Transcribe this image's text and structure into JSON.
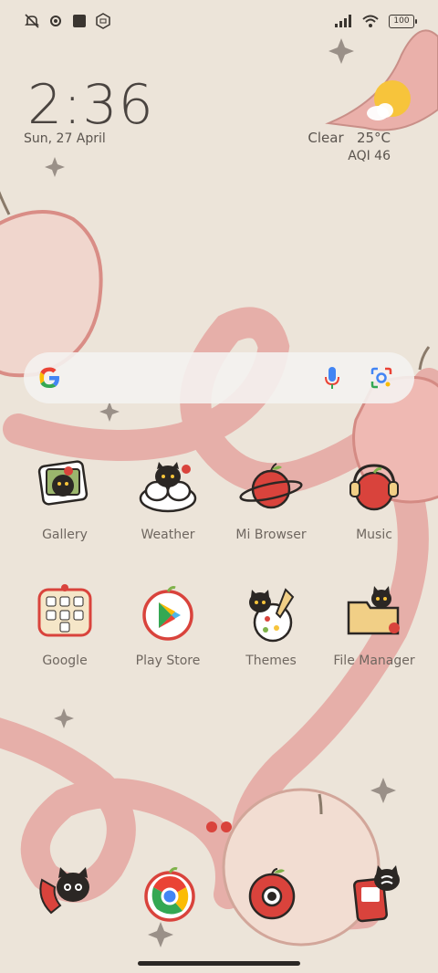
{
  "status_bar": {
    "left_icons": [
      "silent-icon",
      "settings-gear-icon",
      "square-notification-icon",
      "mi-shield-icon"
    ],
    "right_icons": [
      "signal-icon",
      "wifi-icon"
    ],
    "battery": "100"
  },
  "clock": {
    "time": "2:36",
    "date": "Sun, 27 April"
  },
  "weather": {
    "condition": "Clear",
    "temperature": "25°C",
    "aqi": "AQI 46"
  },
  "search": {
    "icons": [
      "google-g-icon",
      "microphone-icon",
      "google-lens-icon"
    ]
  },
  "apps_row1": [
    {
      "label": "Gallery",
      "icon": "gallery-icon"
    },
    {
      "label": "Weather",
      "icon": "weather-app-icon"
    },
    {
      "label": "Mi Browser",
      "icon": "mi-browser-icon"
    },
    {
      "label": "Music",
      "icon": "music-icon"
    }
  ],
  "apps_row2": [
    {
      "label": "Google",
      "icon": "google-folder-icon"
    },
    {
      "label": "Play Store",
      "icon": "play-store-icon"
    },
    {
      "label": "Themes",
      "icon": "themes-icon"
    },
    {
      "label": "File Manager",
      "icon": "file-manager-icon"
    }
  ],
  "dock": [
    "phone-cat-icon",
    "chrome-icon",
    "camera-icon",
    "messages-icon"
  ],
  "colors": {
    "accent_red": "#d9433c",
    "peel_pink": "#e8a9a5",
    "background": "#ece4d9"
  }
}
